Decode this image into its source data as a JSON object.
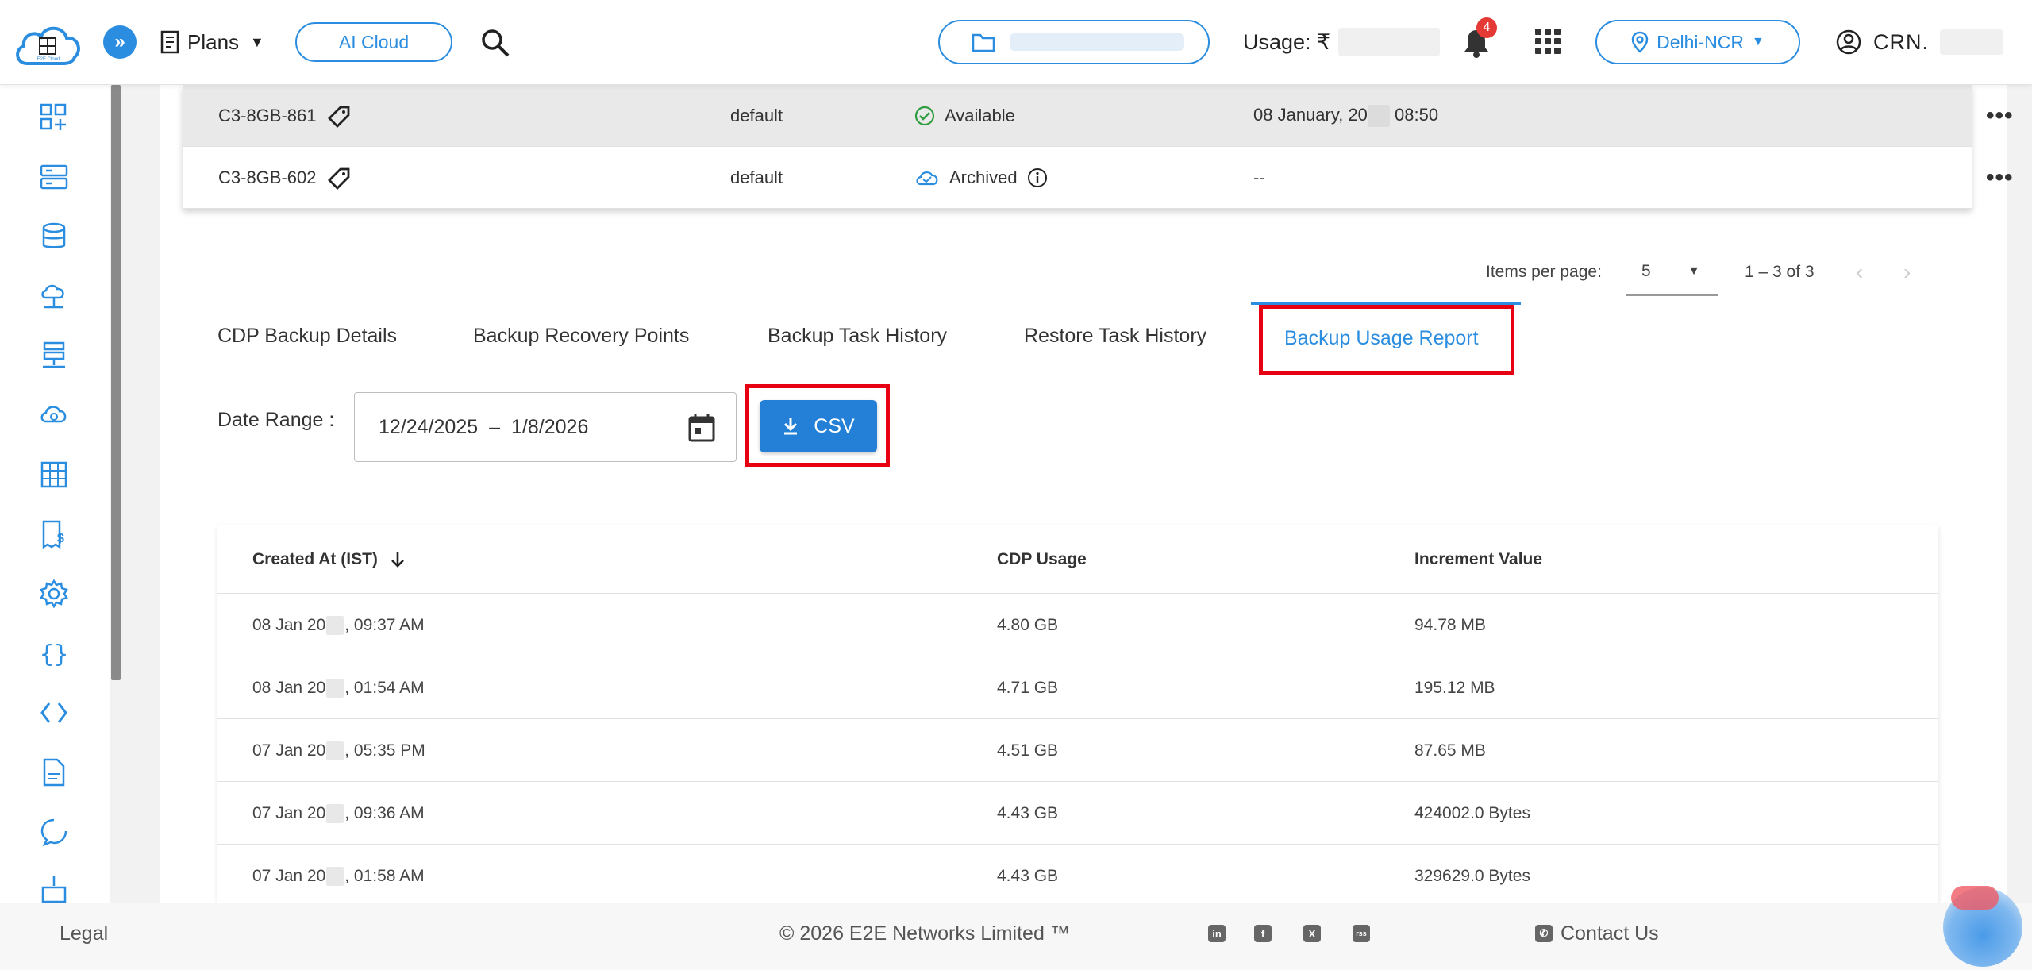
{
  "header": {
    "plans_label": "Plans",
    "ai_cloud_label": "AI Cloud",
    "usage_label": "Usage: ₹",
    "notification_count": "4",
    "region_label": "Delhi-NCR",
    "crn_label": "CRN."
  },
  "instances": [
    {
      "name": "C3-8GB-861",
      "group": "default",
      "status": "Available",
      "date": "08 January, 20",
      "time": "08:50"
    },
    {
      "name": "C3-8GB-602",
      "group": "default",
      "status": "Archived",
      "date": "--",
      "time": ""
    }
  ],
  "pagination": {
    "items_per_page_label": "Items per page:",
    "items_per_page_value": "5",
    "range_label": "1 – 3 of 3"
  },
  "tabs": [
    {
      "label": "CDP Backup Details"
    },
    {
      "label": "Backup Recovery Points"
    },
    {
      "label": "Backup Task History"
    },
    {
      "label": "Restore Task History"
    },
    {
      "label": "Backup Usage Report"
    }
  ],
  "report": {
    "date_range_label": "Date Range :",
    "date_start": "12/24/2025",
    "date_sep": "–",
    "date_end": "1/8/2026",
    "csv_label": "CSV",
    "columns": [
      "Created At (IST)",
      "CDP Usage",
      "Increment Value"
    ],
    "rows": [
      {
        "date_prefix": "08 Jan 20",
        "time": ", 09:37 AM",
        "usage": "4.80 GB",
        "increment": "94.78 MB"
      },
      {
        "date_prefix": "08 Jan 20",
        "time": ", 01:54 AM",
        "usage": "4.71 GB",
        "increment": "195.12 MB"
      },
      {
        "date_prefix": "07 Jan 20",
        "time": ", 05:35 PM",
        "usage": "4.51 GB",
        "increment": "87.65 MB"
      },
      {
        "date_prefix": "07 Jan 20",
        "time": ", 09:36 AM",
        "usage": "4.43 GB",
        "increment": "424002.0 Bytes"
      },
      {
        "date_prefix": "07 Jan 20",
        "time": ", 01:58 AM",
        "usage": "4.43 GB",
        "increment": "329629.0 Bytes"
      }
    ]
  },
  "footer": {
    "legal": "Legal",
    "copyright": "© 2026 E2E Networks Limited ™",
    "contact": "Contact Us",
    "social": [
      "in",
      "f",
      "X",
      "rss"
    ]
  },
  "colors": {
    "accent": "#2b8de0",
    "highlight": "#e60012",
    "available": "#2e9d3f"
  }
}
